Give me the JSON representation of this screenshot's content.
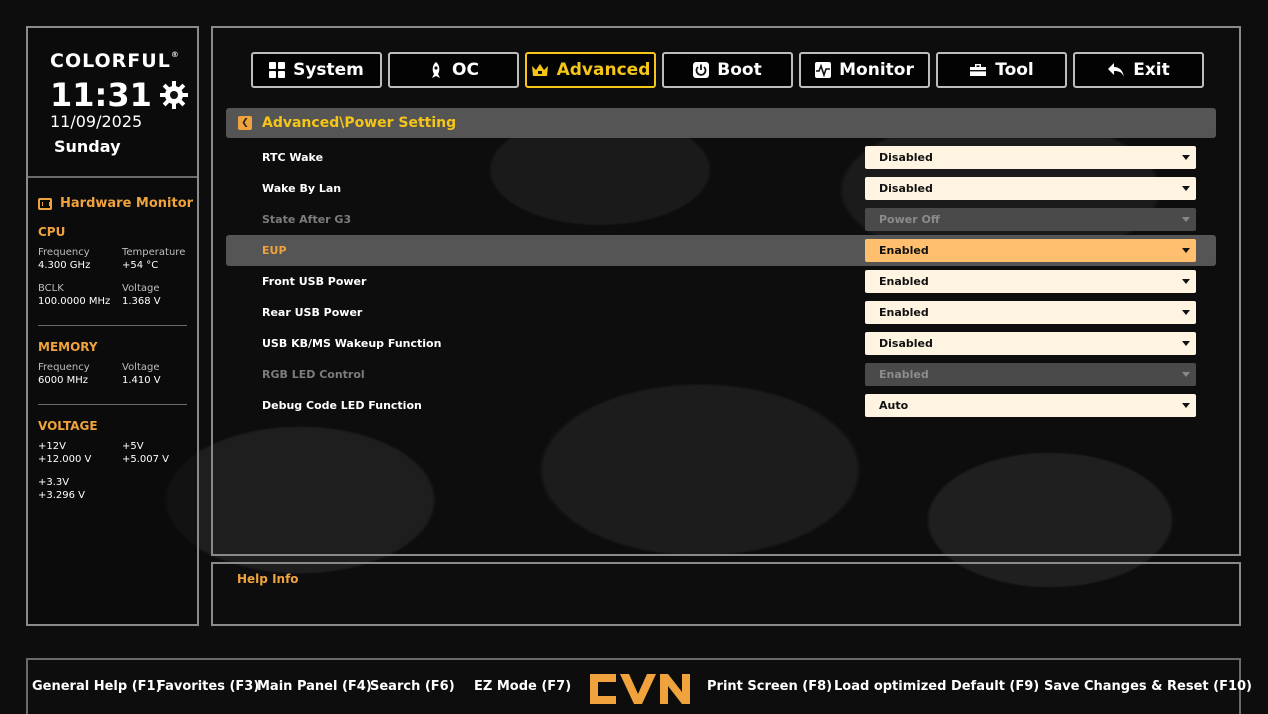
{
  "brand": {
    "name": "COLORFUL",
    "mark": "®"
  },
  "clock": {
    "time": "11:31",
    "date": "11/09/2025",
    "day": "Sunday"
  },
  "hardware_monitor": {
    "title": "Hardware Monitor",
    "cpu": {
      "title": "CPU",
      "frequency_label": "Frequency",
      "frequency": "4.300 GHz",
      "temperature_label": "Temperature",
      "temperature": "+54 °C",
      "bclk_label": "BCLK",
      "bclk": "100.0000 MHz",
      "voltage_label": "Voltage",
      "voltage": "1.368 V"
    },
    "memory": {
      "title": "MEMORY",
      "frequency_label": "Frequency",
      "frequency": "6000 MHz",
      "voltage_label": "Voltage",
      "voltage": "1.410 V"
    },
    "voltage": {
      "title": "VOLTAGE",
      "v12_label": "+12V",
      "v12": "+12.000 V",
      "v5_label": "+5V",
      "v5": "+5.007 V",
      "v33_label": "+3.3V",
      "v33": "+3.296 V"
    }
  },
  "tabs": [
    {
      "label": "System",
      "icon": "grid-icon"
    },
    {
      "label": "OC",
      "icon": "rocket-icon"
    },
    {
      "label": "Advanced",
      "icon": "crown-icon",
      "active": true
    },
    {
      "label": "Boot",
      "icon": "power-icon"
    },
    {
      "label": "Monitor",
      "icon": "pulse-icon"
    },
    {
      "label": "Tool",
      "icon": "toolbox-icon"
    },
    {
      "label": "Exit",
      "icon": "back-arrow-icon"
    }
  ],
  "path": "Advanced\\Power Setting",
  "settings": [
    {
      "label": "RTC Wake",
      "value": "Disabled",
      "state": "normal"
    },
    {
      "label": "Wake By Lan",
      "value": "Disabled",
      "state": "normal"
    },
    {
      "label": "State After G3",
      "value": "Power Off",
      "state": "disabled"
    },
    {
      "label": "EUP",
      "value": "Enabled",
      "state": "selected"
    },
    {
      "label": "Front USB Power",
      "value": "Enabled",
      "state": "normal"
    },
    {
      "label": "Rear USB Power",
      "value": "Enabled",
      "state": "normal"
    },
    {
      "label": "USB KB/MS Wakeup Function",
      "value": "Disabled",
      "state": "normal"
    },
    {
      "label": "RGB LED Control",
      "value": "Enabled",
      "state": "disabled"
    },
    {
      "label": "Debug Code LED Function",
      "value": "Auto",
      "state": "normal"
    }
  ],
  "help": {
    "title": "Help Info"
  },
  "footer": {
    "general_help": "General Help (F1)",
    "favorites": "Favorites (F3)",
    "main_panel": "Main Panel (F4)",
    "search": "Search (F6)",
    "ez_mode": "EZ Mode (F7)",
    "print_screen": "Print Screen (F8)",
    "load_default": "Load optimized Default (F9)",
    "save_reset": "Save Changes & Reset (F10)"
  },
  "colors": {
    "accent": "#f0a33c",
    "active_tab": "#f5c518",
    "selected_dropdown": "#ffbf6e",
    "dropdown_bg": "#fff4e2"
  }
}
